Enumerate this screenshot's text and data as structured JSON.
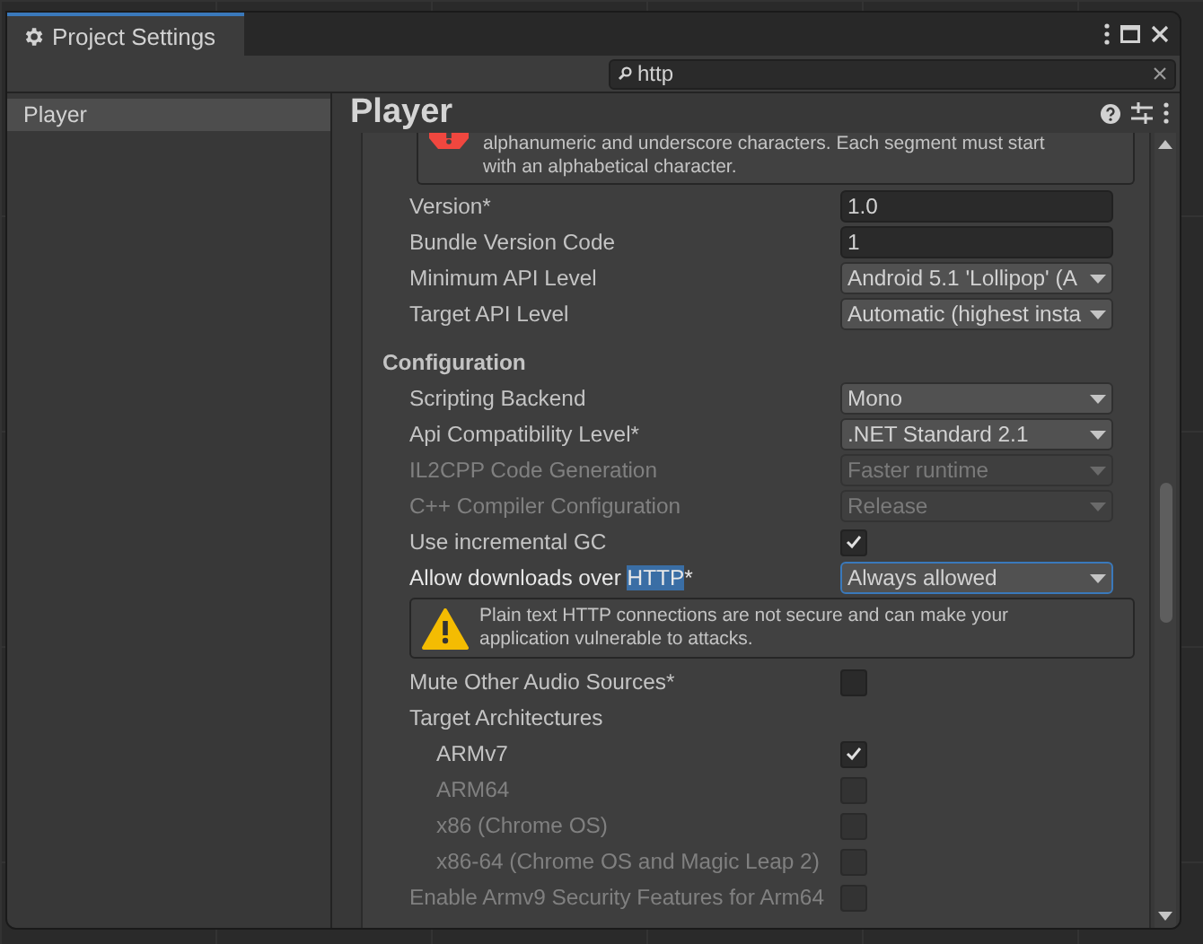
{
  "window": {
    "tab": {
      "title": "Project Settings",
      "selected": true
    }
  },
  "search": {
    "value": "http"
  },
  "sidebar": {
    "items": [
      {
        "label": "Player",
        "selected": true
      }
    ]
  },
  "header": {
    "title": "Player"
  },
  "error": {
    "lines": [
      "alphanumeric and underscore characters. Each segment must start",
      "with an alphabetical character."
    ]
  },
  "rows": [
    {
      "kind": "field",
      "label": "Version*",
      "value": "1.0",
      "disabled": false
    },
    {
      "kind": "field",
      "label": "Bundle Version Code",
      "value": "1",
      "disabled": false
    },
    {
      "kind": "dropdown",
      "label": "Minimum API Level",
      "value": "Android 5.1 'Lollipop' (A",
      "disabled": false,
      "focused": false
    },
    {
      "kind": "dropdown",
      "label": "Target API Level",
      "value": "Automatic (highest insta",
      "disabled": false,
      "focused": false
    },
    {
      "kind": "section",
      "label": "Configuration"
    },
    {
      "kind": "dropdown",
      "label": "Scripting Backend",
      "value": "Mono",
      "disabled": false,
      "focused": false
    },
    {
      "kind": "dropdown",
      "label": "Api Compatibility Level*",
      "value": ".NET Standard 2.1",
      "disabled": false,
      "focused": false
    },
    {
      "kind": "dropdown",
      "label": "IL2CPP Code Generation",
      "value": "Faster runtime",
      "disabled": true,
      "focused": false
    },
    {
      "kind": "dropdown",
      "label": "C++ Compiler Configuration",
      "value": "Release",
      "disabled": true,
      "focused": false
    },
    {
      "kind": "checkbox",
      "label": "Use incremental GC",
      "checked": true,
      "disabled": false
    },
    {
      "kind": "dropdown",
      "label_parts": [
        {
          "text": "Allow downloads over ",
          "match": false
        },
        {
          "text": "HTTP",
          "match": true
        },
        {
          "text": "*",
          "match": false
        }
      ],
      "value": "Always allowed",
      "disabled": false,
      "focused": true
    },
    {
      "kind": "warning",
      "lines": [
        "Plain text HTTP connections are not secure and can make your",
        "application vulnerable to attacks."
      ]
    },
    {
      "kind": "checkbox",
      "label": "Mute Other Audio Sources*",
      "checked": false,
      "disabled": false
    },
    {
      "kind": "group",
      "label": "Target Architectures",
      "children": [
        {
          "kind": "checkbox",
          "label": "ARMv7",
          "checked": true,
          "disabled": false
        },
        {
          "kind": "checkbox",
          "label": "ARM64",
          "checked": false,
          "disabled": true
        },
        {
          "kind": "checkbox",
          "label": "x86 (Chrome OS)",
          "checked": false,
          "disabled": true
        },
        {
          "kind": "checkbox",
          "label": "x86-64 (Chrome OS and Magic Leap 2)",
          "checked": false,
          "disabled": true
        }
      ]
    },
    {
      "kind": "checkbox",
      "label": "Enable Armv9 Security Features for Arm64",
      "checked": false,
      "disabled": true
    }
  ]
}
